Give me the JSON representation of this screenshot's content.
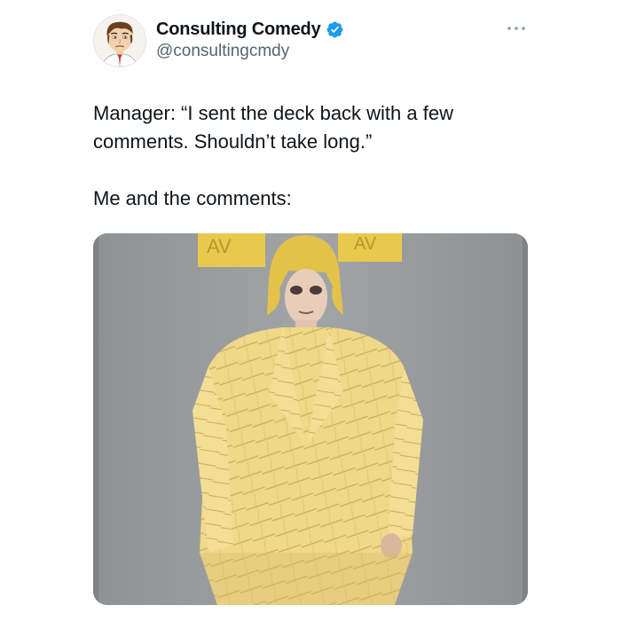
{
  "author": {
    "display_name": "Consulting Comedy",
    "handle": "@consultingcmdy",
    "verified": true,
    "avatar_icon": "cartoon-face-avatar"
  },
  "tweet": {
    "line1": "Manager: “I sent the deck back with a few comments. Shouldn’t take long.”",
    "line2": "Me and the comments:"
  },
  "media": {
    "sign_left_text": "AV",
    "sign_right_text": "AV"
  },
  "colors": {
    "verified_blue": "#1d9bf0",
    "text_primary": "#0f1419",
    "text_secondary": "#536471",
    "sticky_note_yellow": "#f1d98c"
  },
  "icons": {
    "more": "more-dots-icon",
    "verified": "verified-badge-icon"
  }
}
